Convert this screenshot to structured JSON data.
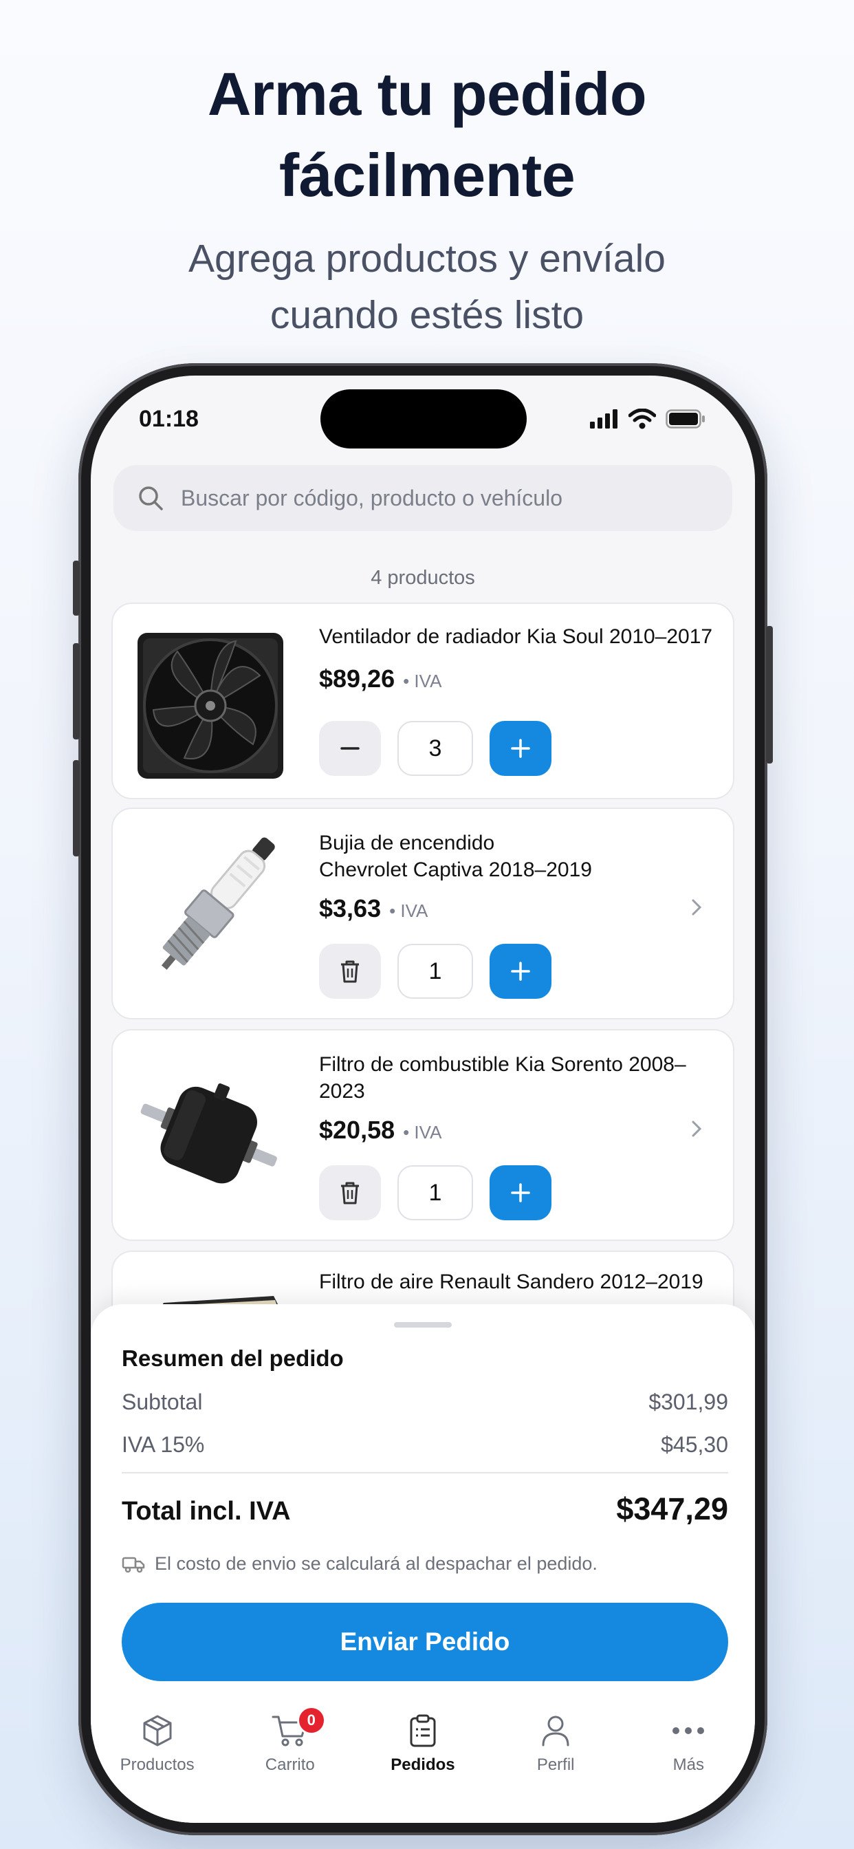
{
  "promo": {
    "title_line1": "Arma tu pedido",
    "title_line2": "fácilmente",
    "subtitle_line1": "Agrega productos y envíalo",
    "subtitle_line2": "cuando estés listo"
  },
  "status_bar": {
    "time": "01:18"
  },
  "search": {
    "placeholder": "Buscar por código, producto o vehículo"
  },
  "product_count": "4 productos",
  "products": [
    {
      "name_line1": "Ventilador de radiador Kia Soul 2010–2017",
      "name_line2": "",
      "price": "$89,26",
      "tax_label": "• IVA",
      "quantity": "3",
      "image": "radiator-fan"
    },
    {
      "name_line1": "Bujia de encendido",
      "name_line2": "Chevrolet Captiva 2018–2019",
      "price": "$3,63",
      "tax_label": "• IVA",
      "quantity": "1",
      "image": "spark-plug"
    },
    {
      "name_line1": "Filtro de combustible Kia Sorento 2008–",
      "name_line2": "2023",
      "price": "$20,58",
      "tax_label": "• IVA",
      "quantity": "1",
      "image": "fuel-filter"
    },
    {
      "name_line1": "Filtro de aire Renault Sandero 2012–2019",
      "name_line2": "",
      "image": "air-filter"
    }
  ],
  "summary": {
    "title": "Resumen del pedido",
    "subtotal_label": "Subtotal",
    "subtotal_value": "$301,99",
    "tax_label": "IVA 15%",
    "tax_value": "$45,30",
    "total_label": "Total incl. IVA",
    "total_value": "$347,29",
    "shipping_note": "El costo de envio se calculará al despachar el pedido.",
    "send_button": "Enviar Pedido"
  },
  "tabs": [
    {
      "label": "Productos",
      "icon": "box-icon"
    },
    {
      "label": "Carrito",
      "icon": "cart-icon",
      "badge": "0"
    },
    {
      "label": "Pedidos",
      "icon": "clipboard-icon",
      "active": true
    },
    {
      "label": "Perfil",
      "icon": "user-icon"
    },
    {
      "label": "Más",
      "icon": "more-icon"
    }
  ],
  "colors": {
    "accent": "#1589e0",
    "badge": "#e4232f",
    "title": "#111a33"
  }
}
